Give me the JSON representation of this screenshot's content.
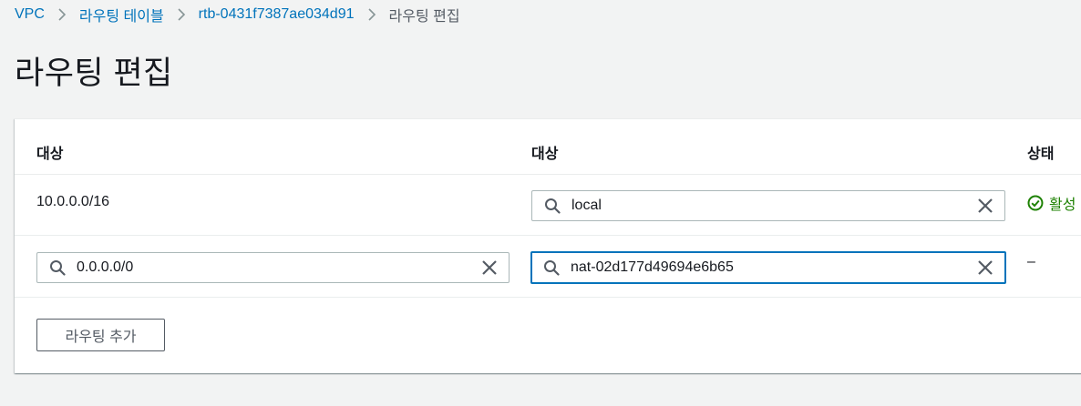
{
  "breadcrumb": {
    "items": [
      {
        "label": "VPC"
      },
      {
        "label": "라우팅 테이블"
      },
      {
        "label": "rtb-0431f7387ae034d91"
      },
      {
        "label": "라우팅 편집"
      }
    ]
  },
  "page": {
    "title": "라우팅 편집"
  },
  "table": {
    "headers": {
      "destination": "대상",
      "target": "대상",
      "status": "상태"
    },
    "rows": [
      {
        "destination": "10.0.0.0/16",
        "target": "local",
        "status": "활성"
      },
      {
        "destination": "0.0.0.0/0",
        "target": "nat-02d177d49694e6b65",
        "status": "–"
      }
    ]
  },
  "actions": {
    "add_route": "라우팅 추가"
  },
  "colors": {
    "link": "#0073bb",
    "active_status": "#1d8102",
    "focus_border": "#0073bb"
  },
  "icons": {
    "search": "search-icon",
    "clear": "close-icon",
    "status_ok": "check-circle-icon",
    "separator": "chevron-right-icon"
  }
}
